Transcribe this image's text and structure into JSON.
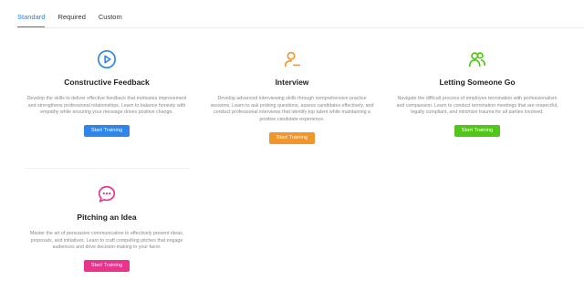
{
  "tabs": [
    "Standard",
    "Required",
    "Custom"
  ],
  "colors": {
    "accent": "#2f7dea"
  },
  "cards": [
    {
      "title": "Constructive Feedback",
      "icon": "play-circle-icon",
      "color": "#2f85e8",
      "desc": "Develop the skills to deliver effective feedback that motivates improvement and strengthens professional relationships. Learn to balance honesty with empathy while ensuring your message drives positive change.",
      "button": "Start Training"
    },
    {
      "title": "Interview",
      "icon": "user-minus-icon",
      "color": "#f0962c",
      "desc": "Develop advanced interviewing skills through comprehensive practice sessions. Learn to ask probing questions, assess candidates effectively, and conduct professional interviews that identify top talent while maintaining a positive candidate experience.",
      "button": "Start Training"
    },
    {
      "title": "Letting Someone Go",
      "icon": "users-icon",
      "color": "#52c41a",
      "desc": "Navigate the difficult process of employee termination with professionalism and compassion. Learn to conduct termination meetings that are respectful, legally compliant, and minimize trauma for all parties involved.",
      "button": "Start Training"
    },
    {
      "title": "Pitching an Idea",
      "icon": "chat-bubble-icon",
      "color": "#e9338d",
      "desc": "Master the art of persuasive communication to effectively present ideas, proposals, and initiatives. Learn to craft compelling pitches that engage audiences and drive decision-making in your favor.",
      "button": "Start Training"
    }
  ]
}
